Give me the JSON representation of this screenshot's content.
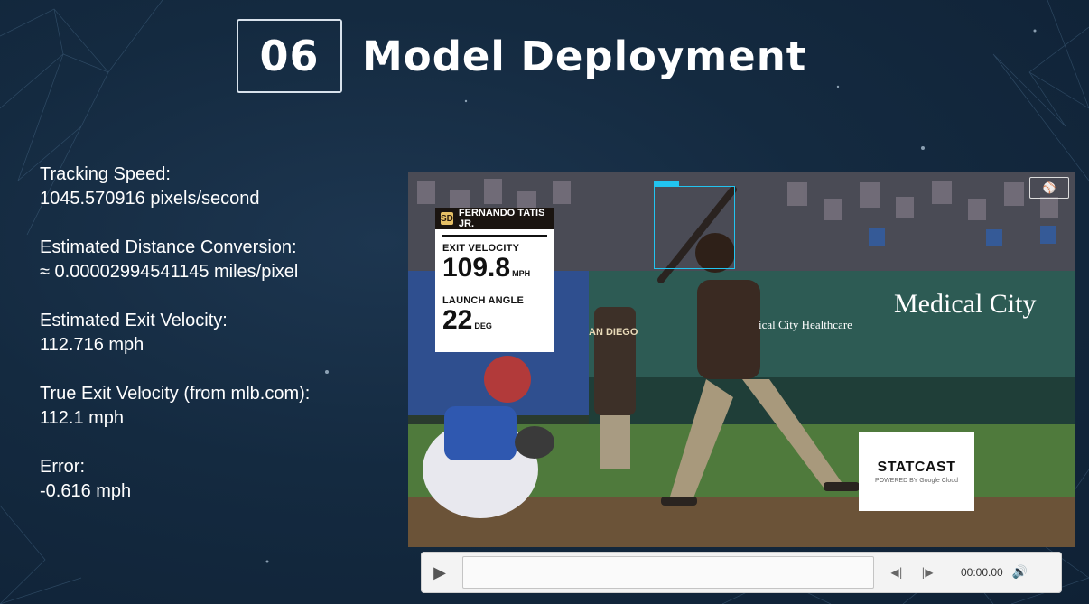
{
  "slide": {
    "number": "06",
    "title": "Model Deployment"
  },
  "stats": [
    {
      "label": "Tracking Speed:",
      "value": "1045.570916 pixels/second"
    },
    {
      "label": "Estimated Distance Conversion:",
      "value": "≈ 0.00002994541145 miles/pixel"
    },
    {
      "label": "Estimated Exit Velocity:",
      "value": "112.716 mph"
    },
    {
      "label": "True Exit Velocity (from mlb.com):",
      "value": "112.1 mph"
    },
    {
      "label": "Error:",
      "value": "-0.616 mph"
    }
  ],
  "video": {
    "player_name": "FERNANDO TATIS JR.",
    "exit_velocity_label": "EXIT VELOCITY",
    "exit_velocity_value": "109.8",
    "exit_velocity_unit": "MPH",
    "launch_angle_label": "LAUNCH ANGLE",
    "launch_angle_value": "22",
    "launch_angle_unit": "DEG",
    "statcast_brand": "STATCAST",
    "statcast_sub": "POWERED BY Google Cloud",
    "ad_text": "Medical City",
    "ad_text_small": "ical City Healthcare",
    "jersey_text": "AN DIEGO"
  },
  "controls": {
    "time": "00:00.00",
    "play_icon": "play-icon",
    "prev_icon": "step-back-icon",
    "next_icon": "step-forward-icon",
    "volume_icon": "volume-icon"
  },
  "colors": {
    "background": "#142a40",
    "tracking_box": "#22c4f0"
  }
}
